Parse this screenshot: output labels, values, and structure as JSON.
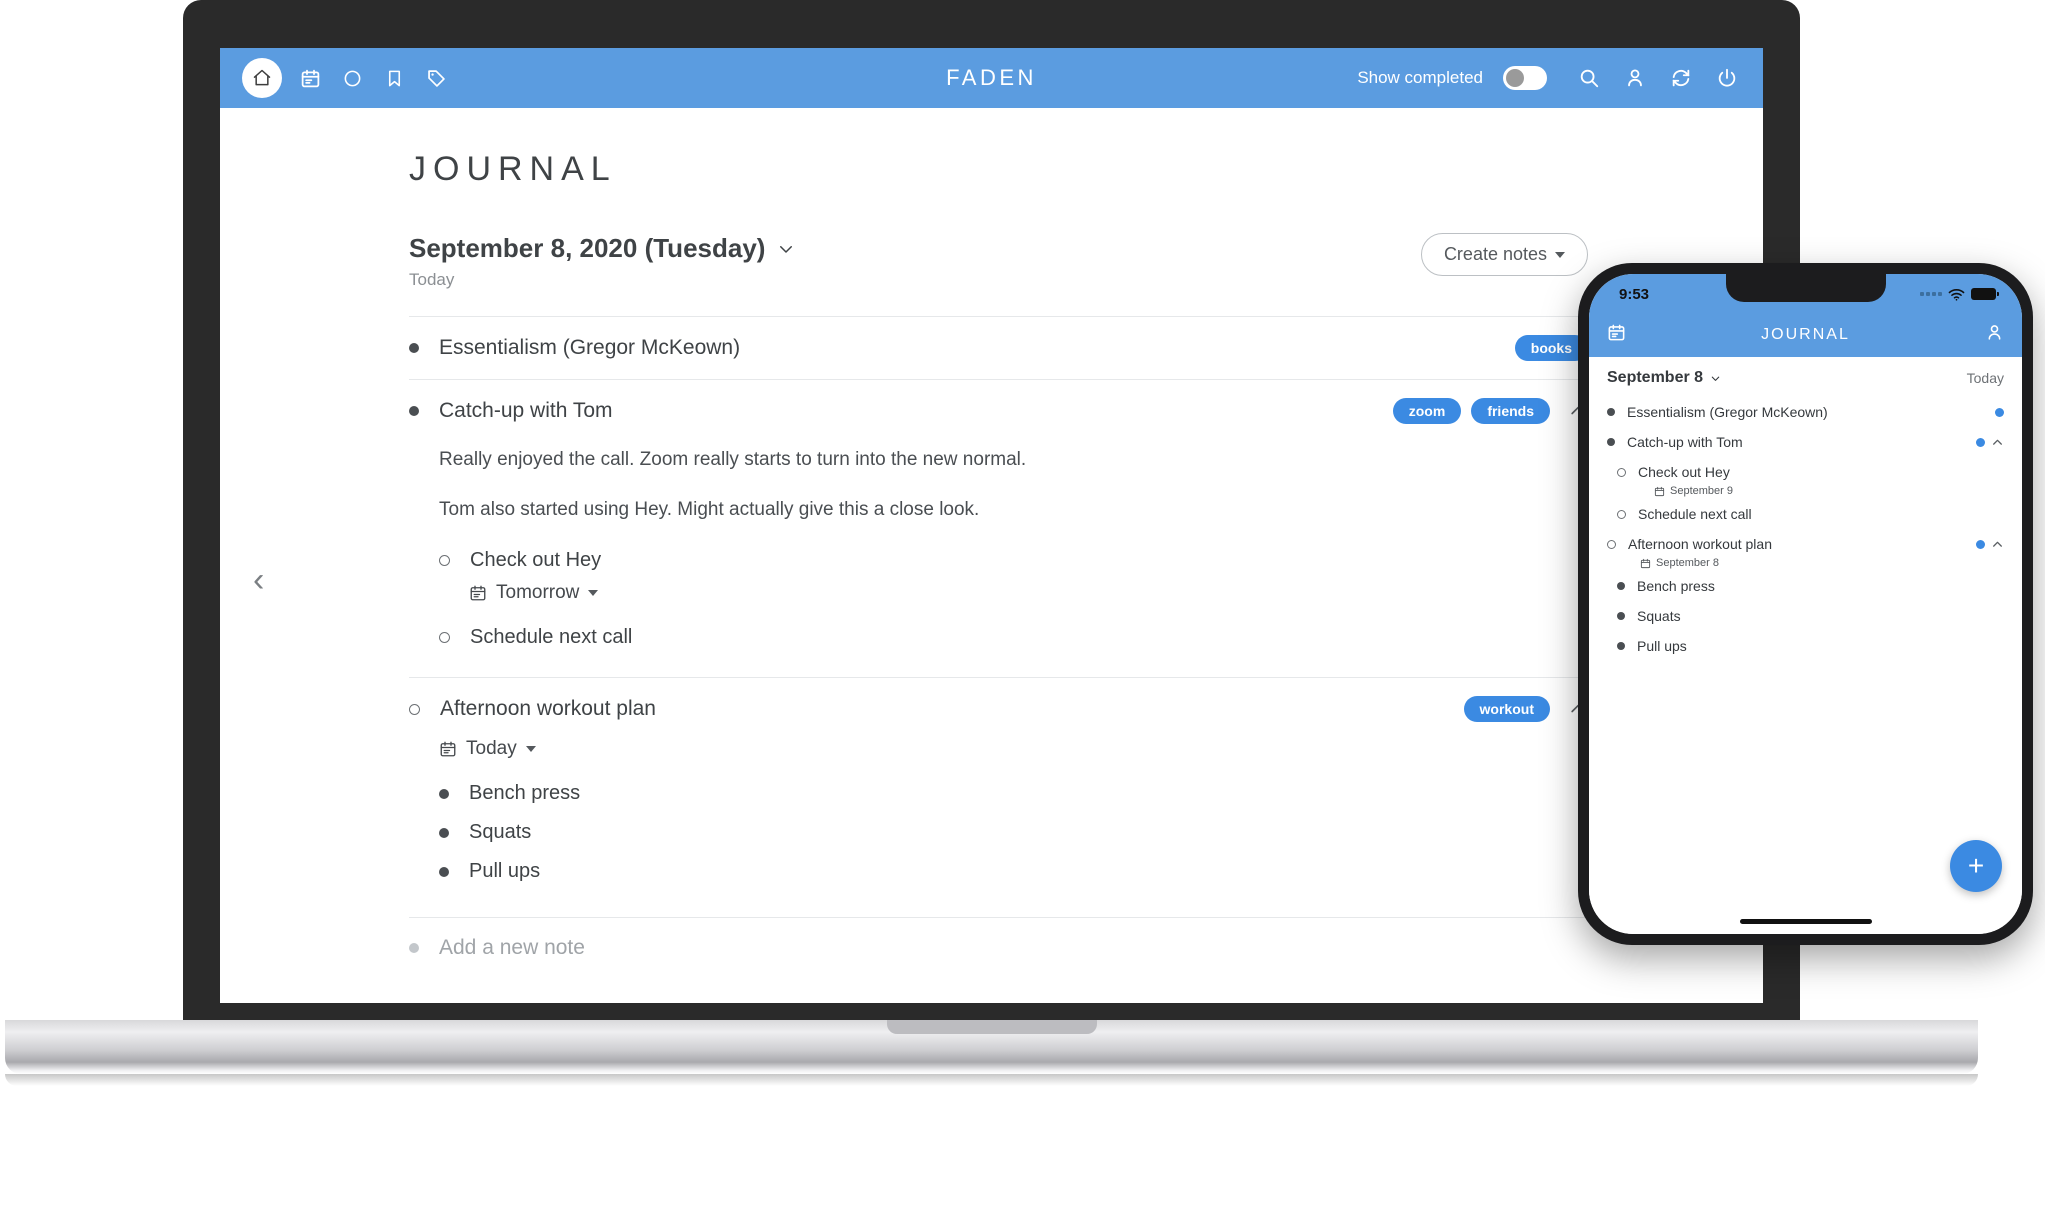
{
  "desktop": {
    "toolbar": {
      "icons_left": [
        "home-icon",
        "calendar-icon",
        "circle-icon",
        "bookmark-icon",
        "tag-icon"
      ],
      "app_title": "FADEN",
      "show_completed_label": "Show completed",
      "toggle_state": "off",
      "icons_right": [
        "search-icon",
        "person-icon",
        "sync-icon",
        "power-icon"
      ]
    },
    "page_title": "JOURNAL",
    "date_heading": "September 8, 2020 (Tuesday)",
    "date_sub": "Today",
    "create_notes_label": "Create notes",
    "back_arrow": "‹",
    "notes": [
      {
        "text": "Essentialism (Gregor McKeown)",
        "bullet": "filled",
        "tags": [
          "books"
        ],
        "collapsible": false
      },
      {
        "text": "Catch-up with Tom",
        "bullet": "filled",
        "tags": [
          "zoom",
          "friends"
        ],
        "collapsible": true,
        "paragraphs": [
          "Really enjoyed the call. Zoom really starts to turn into the new normal.",
          "Tom also started using Hey. Might actually give this a close look."
        ],
        "children": [
          {
            "text": "Check out Hey",
            "bullet": "open",
            "date": "Tomorrow"
          },
          {
            "text": "Schedule next call",
            "bullet": "open"
          }
        ]
      },
      {
        "text": "Afternoon workout plan",
        "bullet": "open",
        "tags": [
          "workout"
        ],
        "collapsible": true,
        "date": "Today",
        "children": [
          {
            "text": "Bench press",
            "bullet": "filled"
          },
          {
            "text": "Squats",
            "bullet": "filled"
          },
          {
            "text": "Pull ups",
            "bullet": "filled"
          }
        ]
      }
    ],
    "add_note_label": "Add a new note"
  },
  "phone": {
    "status": {
      "time": "9:53",
      "wifi": "wifi-icon",
      "battery": "battery-icon"
    },
    "nav": {
      "left_icon": "calendar-icon",
      "title": "JOURNAL",
      "right_icon": "person-icon"
    },
    "date_heading": "September 8",
    "today_label": "Today",
    "fab_label": "+",
    "rows": [
      {
        "text": "Essentialism (Gregor McKeown)",
        "bullet": "filled",
        "indent": 0,
        "dot": true,
        "chevron": false
      },
      {
        "text": "Catch-up with Tom",
        "bullet": "filled",
        "indent": 0,
        "dot": true,
        "chevron": true
      },
      {
        "text": "Check out Hey",
        "bullet": "open",
        "indent": 1,
        "date": "September 9",
        "dot": false,
        "chevron": false
      },
      {
        "text": "Schedule next call",
        "bullet": "open",
        "indent": 1,
        "dot": false,
        "chevron": false
      },
      {
        "text": "Afternoon workout plan",
        "bullet": "open",
        "indent": 0,
        "date": "September 8",
        "dot": true,
        "chevron": true
      },
      {
        "text": "Bench press",
        "bullet": "filled",
        "indent": 1,
        "dot": false,
        "chevron": false
      },
      {
        "text": "Squats",
        "bullet": "filled",
        "indent": 1,
        "dot": false,
        "chevron": false
      },
      {
        "text": "Pull ups",
        "bullet": "filled",
        "indent": 1,
        "dot": false,
        "chevron": false
      }
    ]
  },
  "colors": {
    "brand_blue": "#5b9ce0",
    "tag_blue": "#3b8ae2",
    "text_dark": "#3f4346",
    "text_muted": "#8b8f93"
  }
}
